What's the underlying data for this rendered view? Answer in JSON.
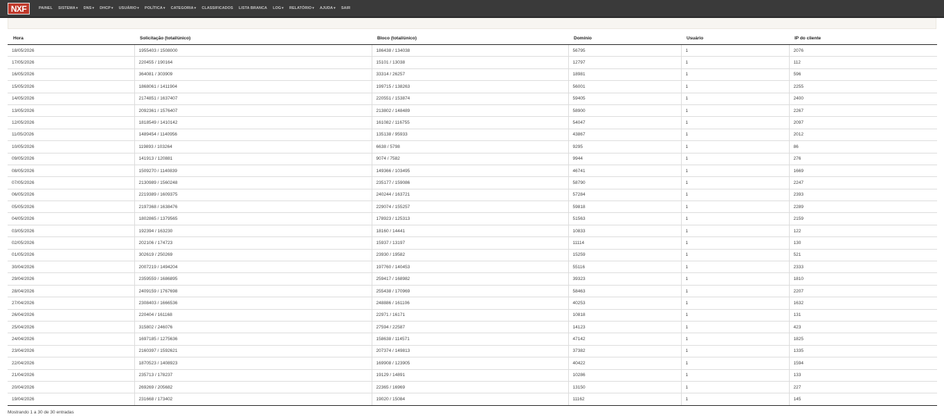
{
  "brand": {
    "logo_text": "NXF",
    "accent": "#c0392b",
    "navbar_bg": "#3a3a3a"
  },
  "menu": [
    {
      "label": "Painel",
      "dropdown": false
    },
    {
      "label": "Sistema",
      "dropdown": true
    },
    {
      "label": "DNS",
      "dropdown": true
    },
    {
      "label": "DHCP",
      "dropdown": true
    },
    {
      "label": "Usuário",
      "dropdown": true
    },
    {
      "label": "Política",
      "dropdown": true
    },
    {
      "label": "Categoria",
      "dropdown": true
    },
    {
      "label": "Classificados",
      "dropdown": false
    },
    {
      "label": "Lista Branca",
      "dropdown": false
    },
    {
      "label": "Log",
      "dropdown": true
    },
    {
      "label": "Relatório",
      "dropdown": true
    },
    {
      "label": "Ajuda",
      "dropdown": true
    },
    {
      "label": "Sair",
      "dropdown": false
    }
  ],
  "table": {
    "columns": [
      "Hora",
      "Solicitação (total/único)",
      "Bloco (total/único)",
      "Domínio",
      "Usuário",
      "IP do cliente"
    ],
    "rows": [
      [
        "18/05/2026",
        "1955403 / 1508000",
        "186438 / 134038",
        "56795",
        "1",
        "2076"
      ],
      [
        "17/05/2026",
        "220455 / 190164",
        "15101 / 13038",
        "12797",
        "1",
        "112"
      ],
      [
        "16/05/2026",
        "364081 / 303909",
        "33314 / 26257",
        "18981",
        "1",
        "596"
      ],
      [
        "15/05/2026",
        "1868061 / 1411904",
        "199715 / 138263",
        "56001",
        "1",
        "2255"
      ],
      [
        "14/05/2026",
        "2174851 / 1637407",
        "220551 / 153874",
        "59405",
        "1",
        "2400"
      ],
      [
        "13/05/2026",
        "2092361 / 1576407",
        "213802 / 148489",
        "58900",
        "1",
        "2267"
      ],
      [
        "12/05/2026",
        "1818549 / 1410142",
        "161082 / 116755",
        "54047",
        "1",
        "2097"
      ],
      [
        "11/05/2026",
        "1489454 / 1140956",
        "135138 / 95933",
        "43867",
        "1",
        "2012"
      ],
      [
        "10/05/2026",
        "119893 / 103264",
        "6638 / 5798",
        "9295",
        "1",
        "86"
      ],
      [
        "09/05/2026",
        "141913 / 120881",
        "9074 / 7582",
        "9944",
        "1",
        "276"
      ],
      [
        "08/05/2026",
        "1509270 / 1140839",
        "149366 / 103495",
        "46741",
        "1",
        "1669"
      ],
      [
        "07/05/2026",
        "2130989 / 1560248",
        "235177 / 159086",
        "58790",
        "1",
        "2247"
      ],
      [
        "06/05/2026",
        "2219389 / 1609375",
        "240244 / 163721",
        "57284",
        "1",
        "2393"
      ],
      [
        "05/05/2026",
        "2197368 / 1638476",
        "229074 / 155257",
        "59818",
        "1",
        "2289"
      ],
      [
        "04/05/2026",
        "1802865 / 1379565",
        "178923 / 125313",
        "51563",
        "1",
        "2159"
      ],
      [
        "03/05/2026",
        "192394 / 163230",
        "18160 / 14441",
        "10833",
        "1",
        "122"
      ],
      [
        "02/05/2026",
        "202106 / 174723",
        "15937 / 13197",
        "11114",
        "1",
        "130"
      ],
      [
        "01/05/2026",
        "302619 / 250269",
        "23930 / 19582",
        "15259",
        "1",
        "521"
      ],
      [
        "30/04/2026",
        "2007219 / 1494204",
        "197760 / 140453",
        "55116",
        "1",
        "2333"
      ],
      [
        "29/04/2026",
        "2359559 / 1686895",
        "259417 / 168982",
        "39323",
        "1",
        "1810"
      ],
      [
        "28/04/2026",
        "2409159 / 1767698",
        "255438 / 170969",
        "58463",
        "1",
        "2207"
      ],
      [
        "27/04/2026",
        "2308403 / 1666536",
        "248886 / 161106",
        "40253",
        "1",
        "1632"
      ],
      [
        "26/04/2026",
        "220404 / 161168",
        "22971 / 16171",
        "10818",
        "1",
        "131"
      ],
      [
        "25/04/2026",
        "315802 / 246076",
        "27594 / 22587",
        "14123",
        "1",
        "423"
      ],
      [
        "24/04/2026",
        "1697185 / 1275636",
        "158638 / 114571",
        "47142",
        "1",
        "1825"
      ],
      [
        "23/04/2026",
        "2160397 / 1592621",
        "207374 / 149813",
        "37382",
        "1",
        "1335"
      ],
      [
        "22/04/2026",
        "1870523 / 1408923",
        "169908 / 123905",
        "40422",
        "1",
        "1594"
      ],
      [
        "21/04/2026",
        "235713 / 178237",
        "19129 / 14891",
        "10286",
        "1",
        "133"
      ],
      [
        "20/04/2026",
        "269269 / 205682",
        "22365 / 16969",
        "13150",
        "1",
        "227"
      ],
      [
        "19/04/2026",
        "231668 / 173402",
        "19020 / 15084",
        "11162",
        "1",
        "145"
      ]
    ]
  },
  "info_text": "Mostrando 1 a 30 de 30 entradas"
}
